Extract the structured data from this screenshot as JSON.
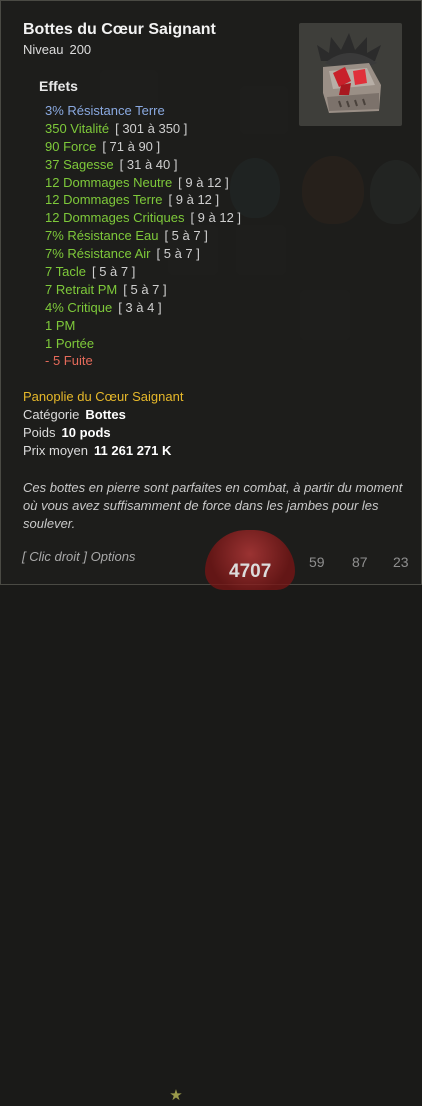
{
  "item": {
    "name": "Bottes du Cœur Saignant",
    "level_label": "Niveau",
    "level": "200",
    "icon": "boots-icon"
  },
  "effects_title": "Effets",
  "effects": [
    {
      "text": "3% Résistance Terre",
      "range": "",
      "kind": "blue"
    },
    {
      "text": "350 Vitalité",
      "range": "[ 301 à 350 ]",
      "kind": "green"
    },
    {
      "text": "90 Force",
      "range": "[ 71 à 90 ]",
      "kind": "green"
    },
    {
      "text": "37 Sagesse",
      "range": "[ 31 à 40 ]",
      "kind": "green"
    },
    {
      "text": "12 Dommages Neutre",
      "range": "[ 9 à 12 ]",
      "kind": "green"
    },
    {
      "text": "12 Dommages Terre",
      "range": "[ 9 à 12 ]",
      "kind": "green"
    },
    {
      "text": "12 Dommages Critiques",
      "range": "[ 9 à 12 ]",
      "kind": "green"
    },
    {
      "text": "7% Résistance Eau",
      "range": "[ 5 à 7 ]",
      "kind": "green"
    },
    {
      "text": "7% Résistance Air",
      "range": "[ 5 à 7 ]",
      "kind": "green"
    },
    {
      "text": "7 Tacle",
      "range": "[ 5 à 7 ]",
      "kind": "green"
    },
    {
      "text": "7 Retrait PM",
      "range": "[ 5 à 7 ]",
      "kind": "green"
    },
    {
      "text": "4% Critique",
      "range": "[ 3 à 4 ]",
      "kind": "green"
    },
    {
      "text": "1 PM",
      "range": "",
      "kind": "green"
    },
    {
      "text": "1 Portée",
      "range": "",
      "kind": "green"
    },
    {
      "text": "- 5 Fuite",
      "range": "",
      "kind": "neg"
    }
  ],
  "panoply": "Panoplie du Cœur Saignant",
  "props": {
    "category_label": "Catégorie",
    "category": "Bottes",
    "weight_label": "Poids",
    "weight": "10 pods",
    "price_label": "Prix moyen",
    "price": "11 261 271 K"
  },
  "description": "Ces bottes en pierre sont parfaites en combat, à partir du moment où vous avez suffisamment de force dans les jambes pour les soulever.",
  "hint": "[ Clic droit ] Options",
  "hud": {
    "hp": "4707",
    "stat_1": "59",
    "stat_2": "87",
    "stat_3": "23"
  },
  "colors": {
    "effect_blue": "#8aa9e0",
    "effect_green": "#7ec93a",
    "effect_negative": "#e46a5a",
    "panoply": "#e6b82a"
  }
}
